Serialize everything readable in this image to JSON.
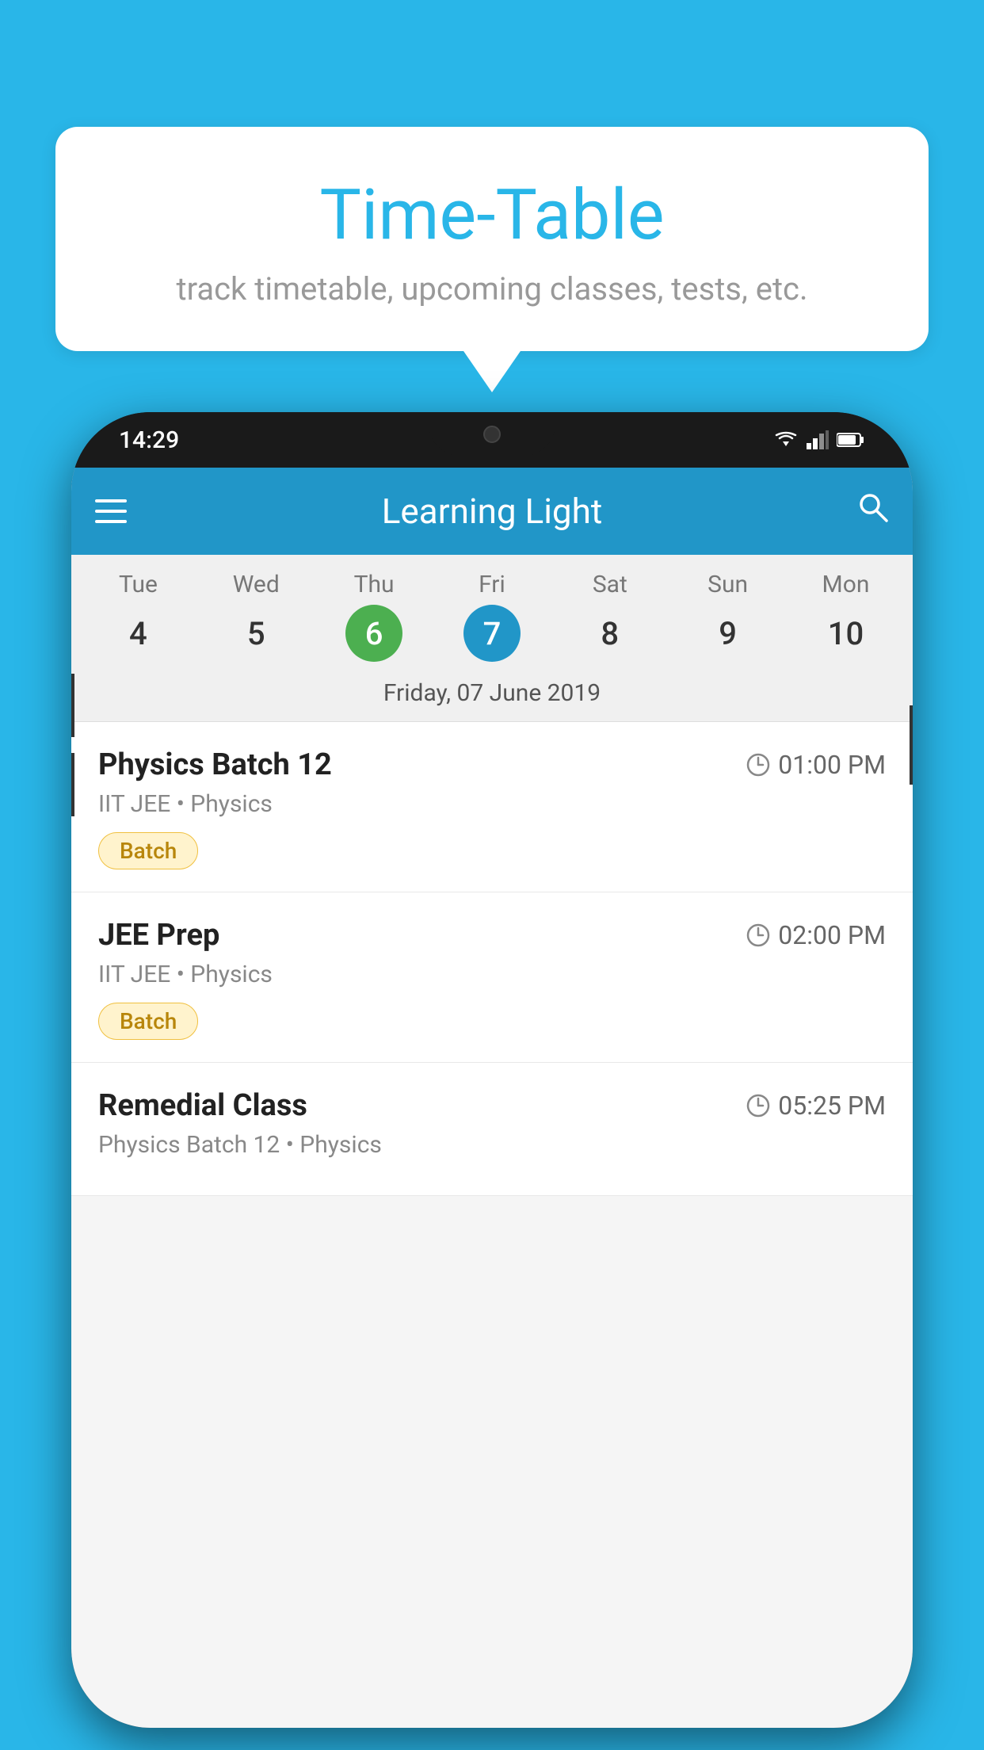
{
  "background_color": "#29B6E8",
  "speech_bubble": {
    "title": "Time-Table",
    "subtitle": "track timetable, upcoming classes, tests, etc."
  },
  "phone": {
    "status_bar": {
      "time": "14:29"
    },
    "app_bar": {
      "title": "Learning Light"
    },
    "calendar": {
      "days": [
        {
          "name": "Tue",
          "number": "4",
          "state": "normal"
        },
        {
          "name": "Wed",
          "number": "5",
          "state": "normal"
        },
        {
          "name": "Thu",
          "number": "6",
          "state": "today"
        },
        {
          "name": "Fri",
          "number": "7",
          "state": "selected"
        },
        {
          "name": "Sat",
          "number": "8",
          "state": "normal"
        },
        {
          "name": "Sun",
          "number": "9",
          "state": "normal"
        },
        {
          "name": "Mon",
          "number": "10",
          "state": "normal"
        }
      ],
      "selected_date_label": "Friday, 07 June 2019"
    },
    "schedule_items": [
      {
        "title": "Physics Batch 12",
        "time": "01:00 PM",
        "subtitle": "IIT JEE • Physics",
        "badge": "Batch"
      },
      {
        "title": "JEE Prep",
        "time": "02:00 PM",
        "subtitle": "IIT JEE • Physics",
        "badge": "Batch"
      },
      {
        "title": "Remedial Class",
        "time": "05:25 PM",
        "subtitle": "Physics Batch 12 • Physics",
        "badge": null
      }
    ]
  },
  "icons": {
    "menu": "☰",
    "search": "🔍",
    "clock": "🕐"
  }
}
